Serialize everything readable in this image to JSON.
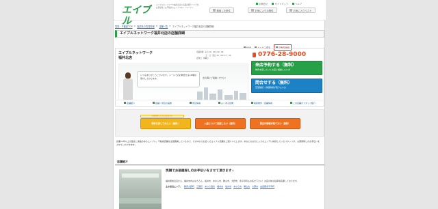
{
  "header": {
    "logo": "エイブル",
    "tagline": "エイブルネットワーク福井北店の店舗詳細ページです。お部屋探しは不動産のエイブルネットワークへ",
    "toplinks": [
      "お問合せ",
      "サイトマップ",
      "ヘルプ"
    ],
    "buttons": {
      "history": "検索した条件",
      "favorites": "お気に入りの物件",
      "favorite_list": "お気に入りリスト"
    }
  },
  "breadcrumbs": [
    "賃貸・不動産TOP",
    "福井県の賃貸情報",
    "店舗一覧",
    "エイブルネットワーク福井北店の店舗詳細"
  ],
  "title": "エイブルネットワーク福井北店の店舗詳細",
  "subtools": {
    "map": "MAP",
    "mail": "メールに送る",
    "print": "印刷用画面"
  },
  "store": {
    "name_line1": "エイブルネットワーク",
    "name_line2": "福井北店",
    "hours": [
      {
        "label": "営業時間",
        "value": "平日 10：00～19：00"
      },
      {
        "label": "",
        "value": "土・日・祝日 10：00～17：00"
      },
      {
        "label": "定休日",
        "value": "水曜日"
      }
    ],
    "tel": "0776-28-9000",
    "greeting": "いつもありがとうございます。メールでのお問合せは24時間受付しております。",
    "greeting2": "お気軽にご連絡ください!"
  },
  "cta": {
    "reserve": {
      "title": "来店予約する（無料）",
      "sub": "物件を探したいとお店に相談したい方"
    },
    "inquiry": {
      "title": "問合せする（無料）",
      "sub": "空室確認・詳細情報が知りたい方"
    }
  },
  "nav": [
    "店舗紹介",
    "店舗・周辺の画像",
    "周辺情報",
    "よくある質問",
    "取扱物件・店舗情報",
    "この店舗のスタッフ紹介"
  ],
  "buttons": {
    "badge": "お部屋探しのプロにおまかせ",
    "b1": "物件を探してほしい（無料）",
    "b2": "入居について相談したい（無料）",
    "b3": "周辺の情報が知りたい（無料）"
  },
  "intro": "創業50年以上の歴史と実績のあるエイブル。不動産店舗を全国展開しているので、その中からお近くのエイブル店舗をご紹介いたします。あなたのお気に入りのエリアに精通しているスタッフが、お部屋探しのお手伝いをさせていただきます。",
  "section": {
    "title": "店舗紹介",
    "heading": "笑顔でお部屋探しのお手伝いをさせて頂きます☆",
    "body": "福井駅前近辺から、福井市内はもちろん、坂井市、あわら市、勝山市、大野市、永平寺町もお任せ下さい！お店の前も駐車場完備しております。",
    "area_label": "主な担当エリア：",
    "areas": [
      "勝見大野町",
      "三国町",
      "あわら温泉",
      "福井市",
      "坂井市",
      "あわら市",
      "勝山市",
      "大野市",
      "吉田郡永平寺町"
    ]
  },
  "colors": {
    "brand_green": "#27a048",
    "tel_orange": "#e94a1f",
    "cta_blue": "#1d82c5"
  }
}
